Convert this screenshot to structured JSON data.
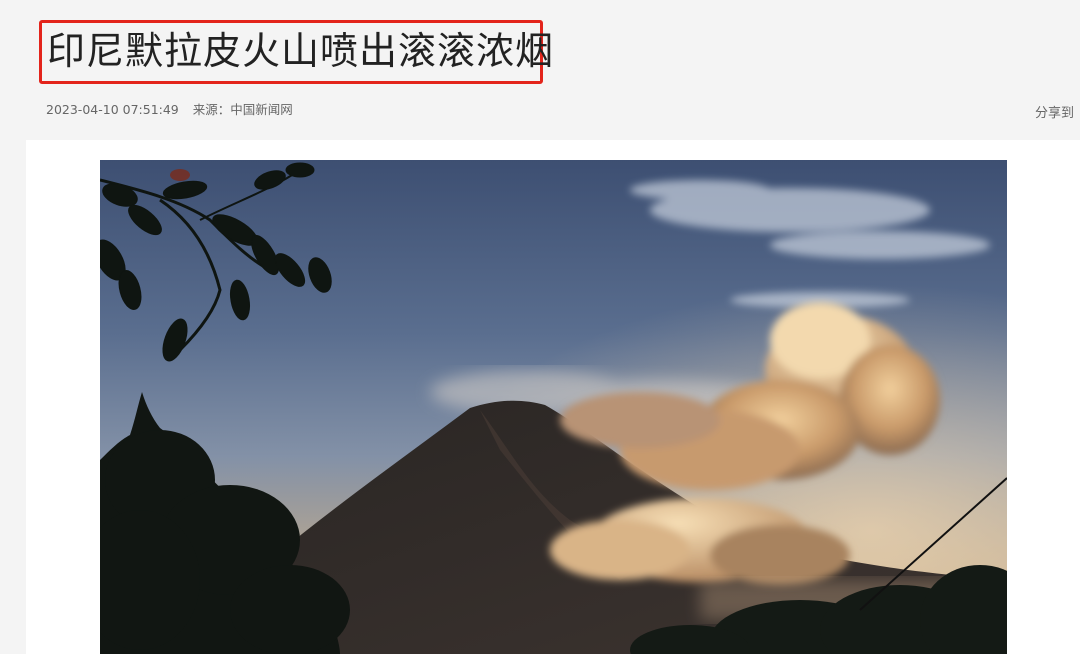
{
  "article": {
    "title": "印尼默拉皮火山喷出滚滚浓烟",
    "date": "2023-04-10 07:51:49",
    "source": "来源：中国新闻网",
    "share_label": "分享到"
  },
  "highlight_color": "#e3241b",
  "image": {
    "subject": "Merapi volcano emitting clouds of smoke at dawn",
    "icon": "photo-image"
  }
}
